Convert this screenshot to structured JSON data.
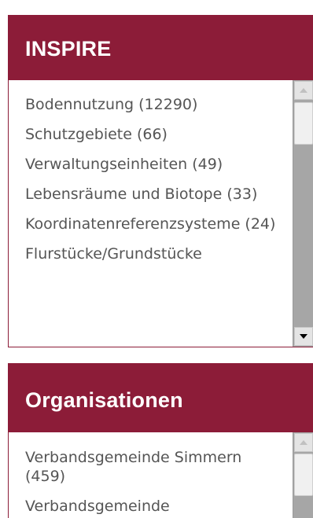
{
  "inspire": {
    "title": "INSPIRE",
    "items": [
      {
        "label": "Bodennutzung (12290)"
      },
      {
        "label": "Schutzgebiete (66)"
      },
      {
        "label": "Verwaltungseinheiten (49)"
      },
      {
        "label": "Lebensräume und Biotope (33)"
      },
      {
        "label": "Koordinatenreferenzsysteme (24)"
      },
      {
        "label": "Flurstücke/Grundstücke"
      }
    ]
  },
  "organisationen": {
    "title": "Organisationen",
    "items": [
      {
        "label": "Verbandsgemeinde Simmern (459)"
      },
      {
        "label": "Verbandsgemeinde"
      }
    ]
  },
  "colors": {
    "header": "#8c1c38",
    "text": "#555555",
    "scrollbar_track": "#a6a6a6"
  },
  "icons": {
    "scroll_up": "triangle-up-icon",
    "scroll_down": "triangle-down-icon"
  }
}
